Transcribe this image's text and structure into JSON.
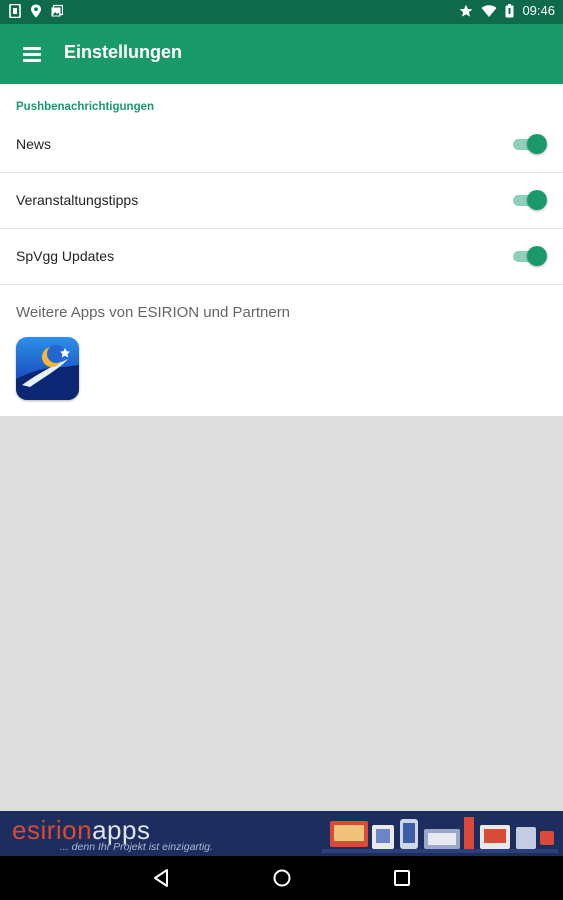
{
  "status_bar": {
    "time": "09:46",
    "left_icons": [
      "sim-icon",
      "location-icon",
      "photo-icon"
    ],
    "right_icons": [
      "star-icon",
      "wifi-icon",
      "battery-icon"
    ]
  },
  "app_bar": {
    "title": "Einstellungen",
    "menu_icon": "hamburger-menu-icon"
  },
  "settings": {
    "section_header": "Pushbenachrichtigungen",
    "items": [
      {
        "label": "News",
        "enabled": true
      },
      {
        "label": "Veranstaltungstipps",
        "enabled": true
      },
      {
        "label": "SpVgg Updates",
        "enabled": true
      }
    ],
    "more_apps_label": "Weitere Apps von ESIRION und Partnern"
  },
  "banner": {
    "brand_part1": "esirion",
    "brand_part2": "apps",
    "tagline": "... denn Ihr Projekt ist einzigartig."
  },
  "nav_bar": {
    "icons": [
      "back-icon",
      "home-icon",
      "recents-icon"
    ]
  },
  "colors": {
    "primary": "#1a9a6b",
    "primary_dark": "#0f6a4b",
    "toggle_track": "#8fd1b8",
    "banner_bg": "#1d2d5d",
    "banner_accent": "#d94b38"
  }
}
